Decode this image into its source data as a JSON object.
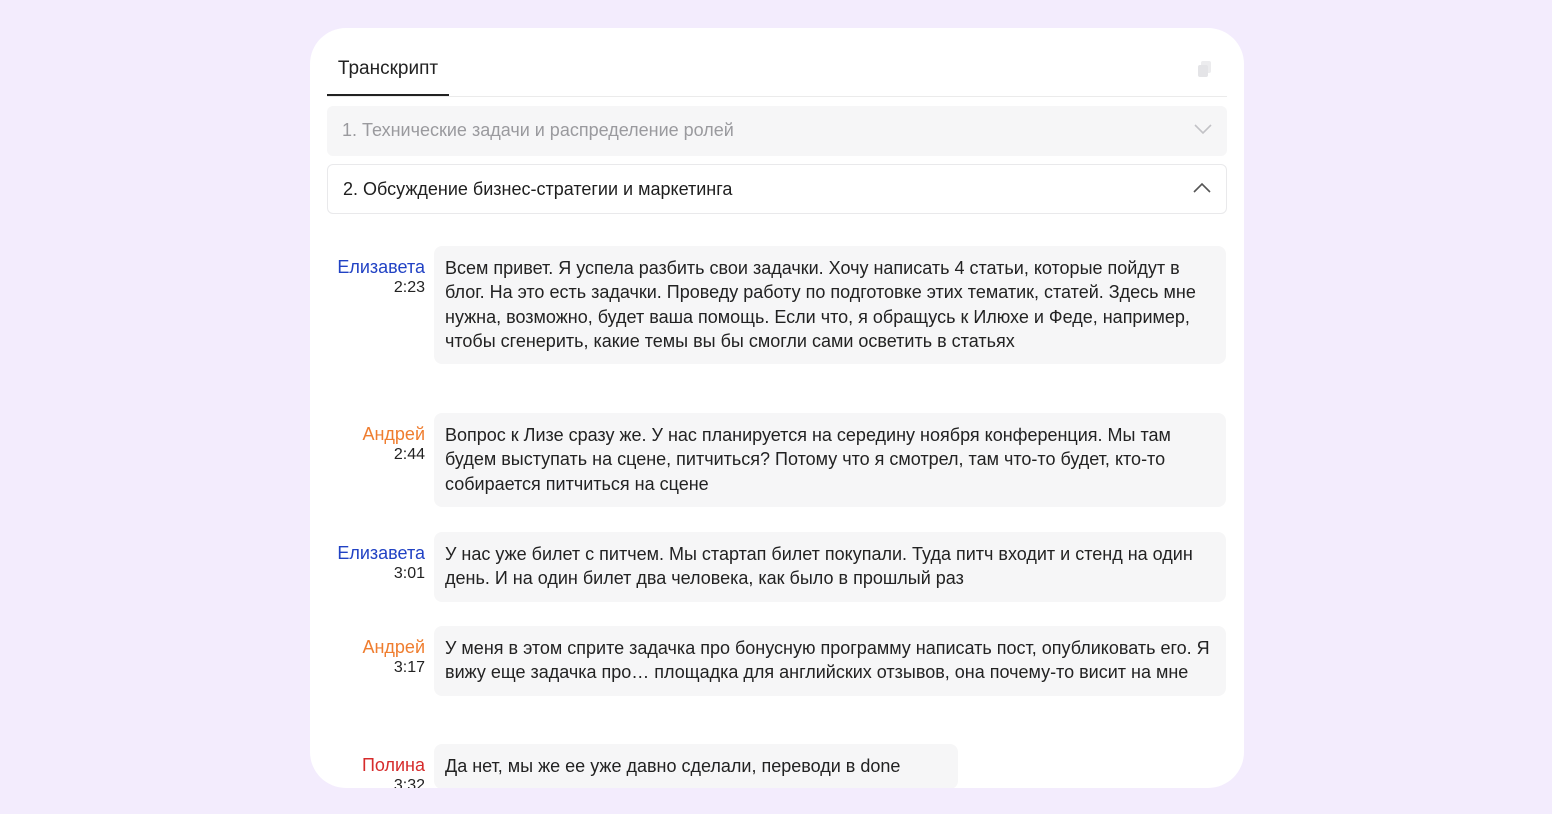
{
  "colors": {
    "page_background": "#f3ecfd",
    "speaker_elizaveta": "#2142c4",
    "speaker_andrey": "#ef7d2f",
    "speaker_polina": "#d62b2b"
  },
  "tabs": [
    {
      "label": "Транскрипт",
      "active": true
    }
  ],
  "toolbar": {
    "copy_icon": "copy-icon"
  },
  "sections": [
    {
      "title": "1. Технические задачи и распределение ролей",
      "expanded": false,
      "icon": "chevron-down-icon"
    },
    {
      "title": "2. Обсуждение бизнес-стратегии и маркетинга",
      "expanded": true,
      "icon": "chevron-up-icon"
    }
  ],
  "messages": [
    {
      "speaker": "Елизавета",
      "time": "2:23",
      "text": "Всем привет. Я успела разбить свои задачки. Хочу написать 4 статьи, которые пойдут в блог. На это есть задачки. Проведу работу по подготовке этих тематик, статей. Здесь мне нужна, возможно, будет ваша помощь. Если что, я обращусь к Илюхе и Феде, например, чтобы сгенерить, какие темы вы бы смогли сами осветить в статьях"
    },
    {
      "speaker": "Андрей",
      "time": "2:44",
      "text": "Вопрос к Лизе сразу же. У нас планируется на середину ноября конференция. Мы там будем выступать на сцене, питчиться? Потому что я смотрел, там что-то будет, кто-то собирается питчиться на сцене"
    },
    {
      "speaker": "Елизавета",
      "time": "3:01",
      "text": "У нас уже билет с питчем. Мы стартап билет покупали. Туда питч входит и стенд на один день. И на один билет два человека, как было в прошлый раз"
    },
    {
      "speaker": "Андрей",
      "time": "3:17",
      "text": "У меня в этом сприте задачка про бонусную программу написать пост, опубликовать его. Я вижу еще задачка про… площадка для английских отзывов, она почему-то висит на мне"
    },
    {
      "speaker": "Полина",
      "time": "3:32",
      "text": "Да нет, мы же ее уже давно сделали, переводи в done"
    }
  ]
}
